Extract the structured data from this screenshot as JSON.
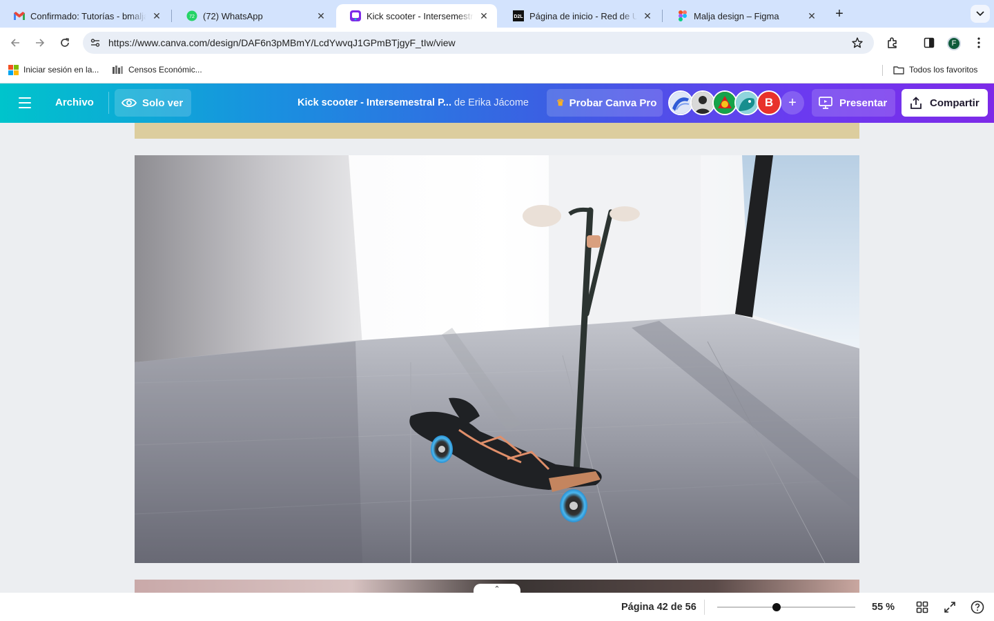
{
  "browser": {
    "tabs": [
      {
        "title": "Confirmado: Tutorías - bmalja",
        "favicon": "gmail-icon",
        "active": false
      },
      {
        "title": "(72) WhatsApp",
        "favicon": "whatsapp-icon",
        "badge": "72",
        "active": false
      },
      {
        "title": "Kick scooter - Intersemestral",
        "favicon": "canva-icon",
        "active": true
      },
      {
        "title": "Página de inicio - Red de Univ",
        "favicon": "d2l-icon",
        "favicon_text": "D2L",
        "active": false
      },
      {
        "title": "Malja design – Figma",
        "favicon": "figma-icon",
        "active": false
      }
    ],
    "new_tab": "+",
    "url": "https://www.canva.com/design/DAF6n3pMBmY/LcdYwvqJ1GPmBTjgyF_tIw/view",
    "profile_initial": "F",
    "bookmarks": [
      {
        "label": "Iniciar sesión en la...",
        "icon": "microsoft-icon"
      },
      {
        "label": "Censos Económic...",
        "icon": "inegi-icon"
      }
    ],
    "all_bookmarks": "Todos los favoritos"
  },
  "canva": {
    "menu_label": "Archivo",
    "view_mode": "Solo ver",
    "doc_title": "Kick scooter - Intersemestral P...",
    "doc_author": "de Erika Jácome",
    "pro_button": "Probar Canva Pro",
    "collaborators": [
      {
        "name": "collaborator-1",
        "color": "#2f5bd6"
      },
      {
        "name": "collaborator-2",
        "color": "#3a3a3a"
      },
      {
        "name": "collaborator-3",
        "color": "#c8121b"
      },
      {
        "name": "collaborator-4",
        "color": "#1a9a9a"
      },
      {
        "name": "collaborator-5",
        "initial": "B",
        "color": "#e8322b"
      }
    ],
    "present_button": "Presentar",
    "share_button": "Compartir"
  },
  "status": {
    "page_info": "Página 42 de 56",
    "zoom_fraction": 0.43,
    "zoom_label": "55 %"
  },
  "colors": {
    "accent_start": "#00c4cc",
    "accent_end": "#7d2ae8"
  }
}
